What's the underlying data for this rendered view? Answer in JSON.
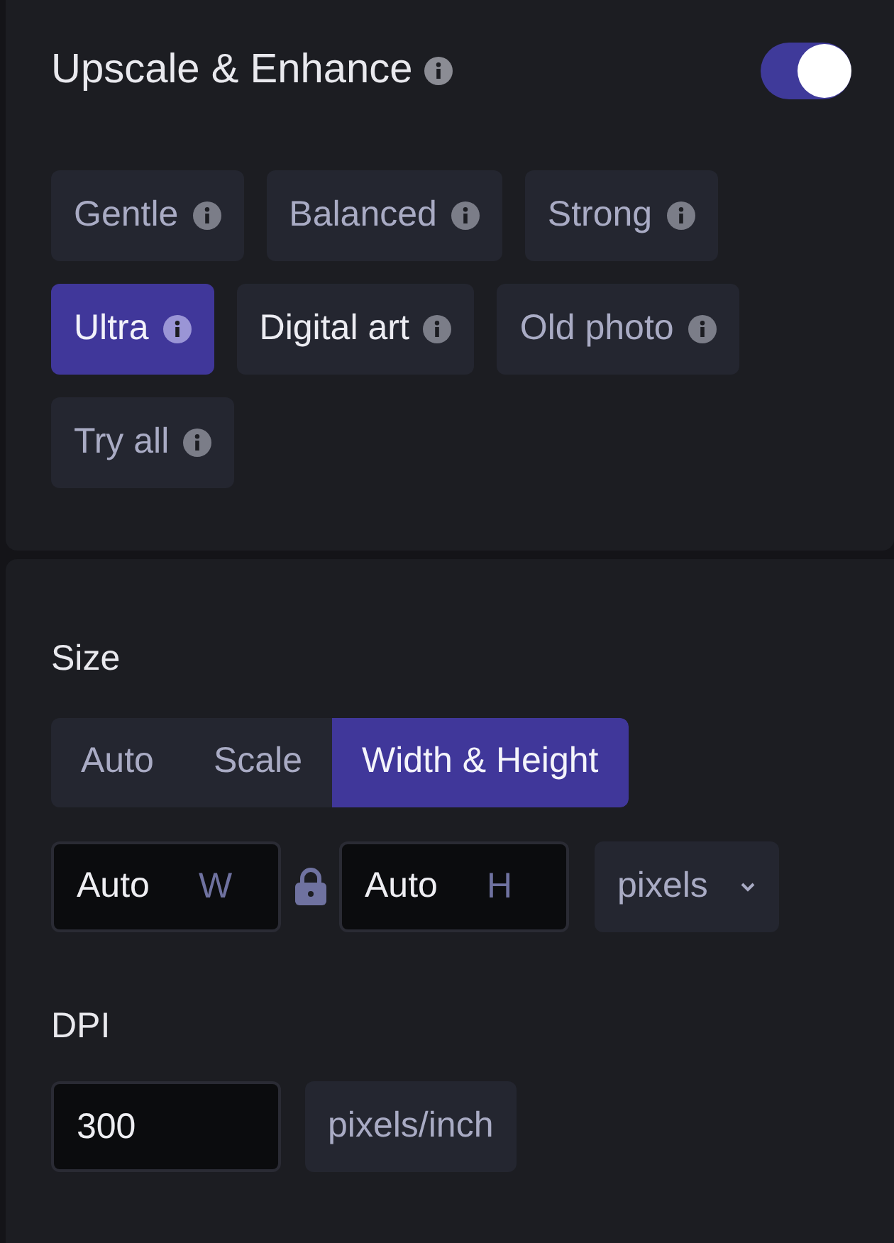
{
  "enhance": {
    "title": "Upscale & Enhance",
    "enabled": true,
    "presets": [
      {
        "label": "Gentle",
        "selected": false,
        "highlighted": false
      },
      {
        "label": "Balanced",
        "selected": false,
        "highlighted": false
      },
      {
        "label": "Strong",
        "selected": false,
        "highlighted": false
      },
      {
        "label": "Ultra",
        "selected": true,
        "highlighted": false
      },
      {
        "label": "Digital art",
        "selected": false,
        "highlighted": true
      },
      {
        "label": "Old photo",
        "selected": false,
        "highlighted": false
      },
      {
        "label": "Try all",
        "selected": false,
        "highlighted": false
      }
    ]
  },
  "size": {
    "label": "Size",
    "modes": [
      {
        "label": "Auto",
        "selected": false
      },
      {
        "label": "Scale",
        "selected": false
      },
      {
        "label": "Width & Height",
        "selected": true
      }
    ],
    "width": {
      "value": "Auto",
      "suffix": "W"
    },
    "locked": true,
    "height": {
      "value": "Auto",
      "suffix": "H"
    },
    "unit": "pixels"
  },
  "dpi": {
    "label": "DPI",
    "value": "300",
    "unit": "pixels/inch"
  }
}
